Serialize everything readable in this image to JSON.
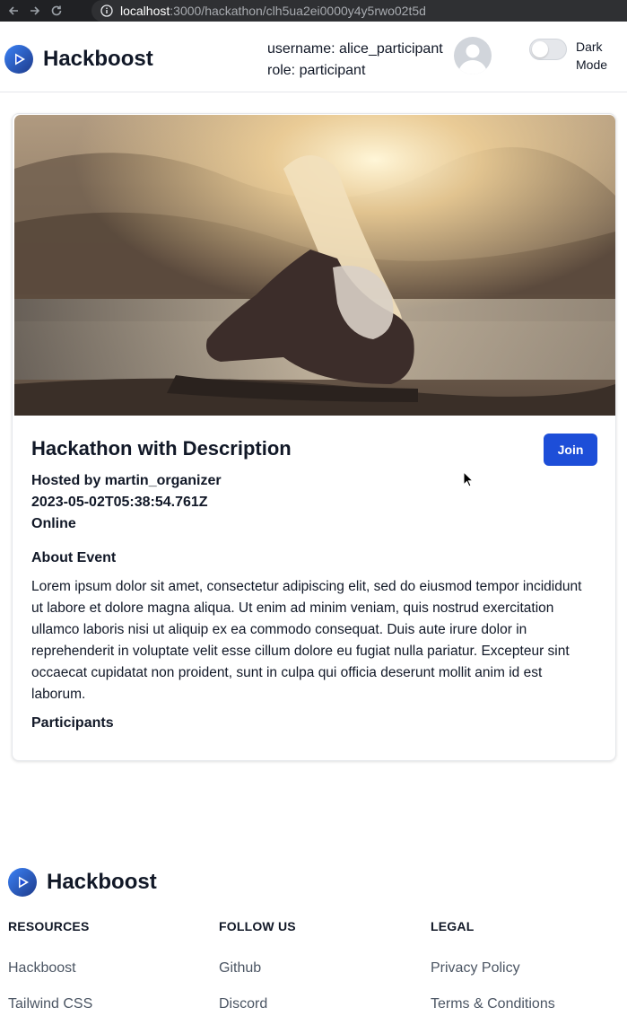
{
  "browser": {
    "url_host": "localhost",
    "url_path": ":3000/hackathon/clh5ua2ei0000y4y5rwo02t5d"
  },
  "header": {
    "brand": "Hackboost",
    "username_line": "username: alice_participant",
    "role_line": "role: participant",
    "dark_mode_label": "Dark Mode",
    "dark_mode_on": false
  },
  "event": {
    "title": "Hackathon with Description",
    "join_label": "Join",
    "hosted_by": "Hosted by martin_organizer",
    "date": "2023-05-02T05:38:54.761Z",
    "location": "Online",
    "about_heading": "About Event",
    "about_text": "Lorem ipsum dolor sit amet, consectetur adipiscing elit, sed do eiusmod tempor incididunt ut labore et dolore magna aliqua. Ut enim ad minim veniam, quis nostrud exercitation ullamco laboris nisi ut aliquip ex ea commodo consequat. Duis aute irure dolor in reprehenderit in voluptate velit esse cillum dolore eu fugiat nulla pariatur. Excepteur sint occaecat cupidatat non proident, sunt in culpa qui officia deserunt mollit anim id est laborum.",
    "participants_heading": "Participants"
  },
  "footer": {
    "brand": "Hackboost",
    "columns": [
      {
        "heading": "RESOURCES",
        "links": [
          "Hackboost",
          "Tailwind CSS"
        ]
      },
      {
        "heading": "FOLLOW US",
        "links": [
          "Github",
          "Discord"
        ]
      },
      {
        "heading": "LEGAL",
        "links": [
          "Privacy Policy",
          "Terms & Conditions"
        ]
      }
    ]
  },
  "colors": {
    "accent": "#1d4ed8",
    "text": "#111827",
    "muted": "#4b5563"
  }
}
